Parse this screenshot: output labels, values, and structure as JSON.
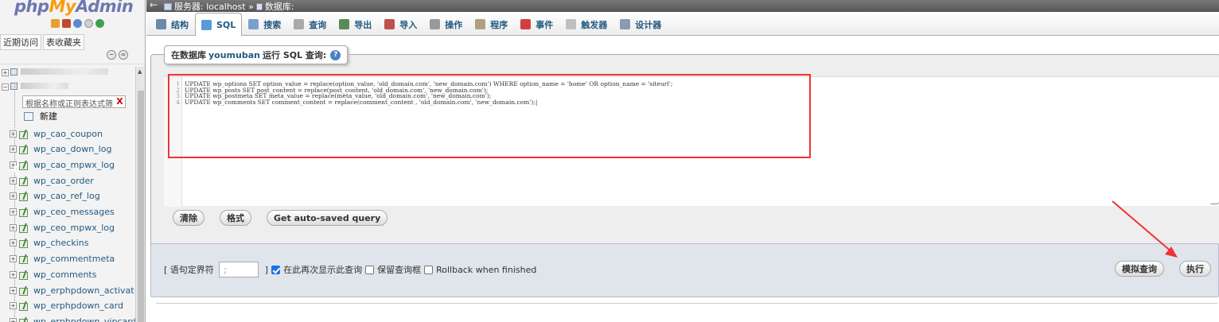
{
  "nav": {
    "logo_php": "php",
    "logo_my": "My",
    "logo_admin": "Admin",
    "tab_recent": "近期访问",
    "tab_favorites": "表收藏夹",
    "filter_placeholder": "根据名称或正则表达式筛",
    "filter_clear": "X",
    "new_label": "新建",
    "tables": [
      "wp_cao_coupon",
      "wp_cao_down_log",
      "wp_cao_mpwx_log",
      "wp_cao_order",
      "wp_cao_ref_log",
      "wp_ceo_messages",
      "wp_ceo_mpwx_log",
      "wp_checkins",
      "wp_commentmeta",
      "wp_comments",
      "wp_erphpdown_activat",
      "wp_erphpdown_card",
      "wp_erphpdown_vipcard"
    ]
  },
  "topbar": {
    "server_label": "服务器: localhost »",
    "db_label": "数据库:"
  },
  "tabs": [
    {
      "label": "结构",
      "icon": "structure-icon",
      "color": "#6a8aaa"
    },
    {
      "label": "SQL",
      "icon": "sql-icon",
      "color": "#5a9ad8"
    },
    {
      "label": "搜索",
      "icon": "search-icon",
      "color": "#7aa0d0"
    },
    {
      "label": "查询",
      "icon": "query-icon",
      "color": "#aaaaaa"
    },
    {
      "label": "导出",
      "icon": "export-icon",
      "color": "#5a8a5a"
    },
    {
      "label": "导入",
      "icon": "import-icon",
      "color": "#c05050"
    },
    {
      "label": "操作",
      "icon": "operations-icon",
      "color": "#9a9a9a"
    },
    {
      "label": "程序",
      "icon": "routines-icon",
      "color": "#b0a080"
    },
    {
      "label": "事件",
      "icon": "events-icon",
      "color": "#d04040"
    },
    {
      "label": "触发器",
      "icon": "triggers-icon",
      "color": "#c0c0c0"
    },
    {
      "label": "设计器",
      "icon": "designer-icon",
      "color": "#8a9ab0"
    }
  ],
  "query_box": {
    "legend_prefix": "在数据库",
    "database": "youmuban",
    "legend_suffix": "运行 SQL 查询:",
    "lines": [
      {
        "n": "1",
        "text": "UPDATE wp_options SET option_value = replace(option_value, 'old_domain.com', 'new_domain.com') WHERE option_name = 'home' OR option_name = 'siteurl';"
      },
      {
        "n": "2",
        "text": "UPDATE wp_posts SET post_content = replace(post_content, 'old_domain.com', 'new_domain.com');"
      },
      {
        "n": "3",
        "text": "UPDATE wp_postmeta SET meta_value = replace(meta_value, 'old_domain.com', 'new_domain.com');"
      },
      {
        "n": "4",
        "text": "UPDATE wp_comments SET comment_content = replace(comment_content , 'old_domain.com', 'new_domain.com');|"
      }
    ]
  },
  "buttons": {
    "clear": "清除",
    "format": "格式",
    "autosaved": "Get auto-saved query",
    "simulate": "模拟查询",
    "go": "执行"
  },
  "options": {
    "delimiter_label_open": "[ 语句定界符",
    "delimiter_value": ";",
    "delimiter_label_close": "]",
    "show_again": "在此再次显示此查询",
    "show_again_checked": true,
    "retain_box": "保留查询框",
    "retain_box_checked": false,
    "rollback": "Rollback when finished",
    "rollback_checked": false
  },
  "colors": {
    "highlight_border": "#ee3333",
    "annotation_arrow": "#ee3333",
    "link": "#235a81"
  }
}
